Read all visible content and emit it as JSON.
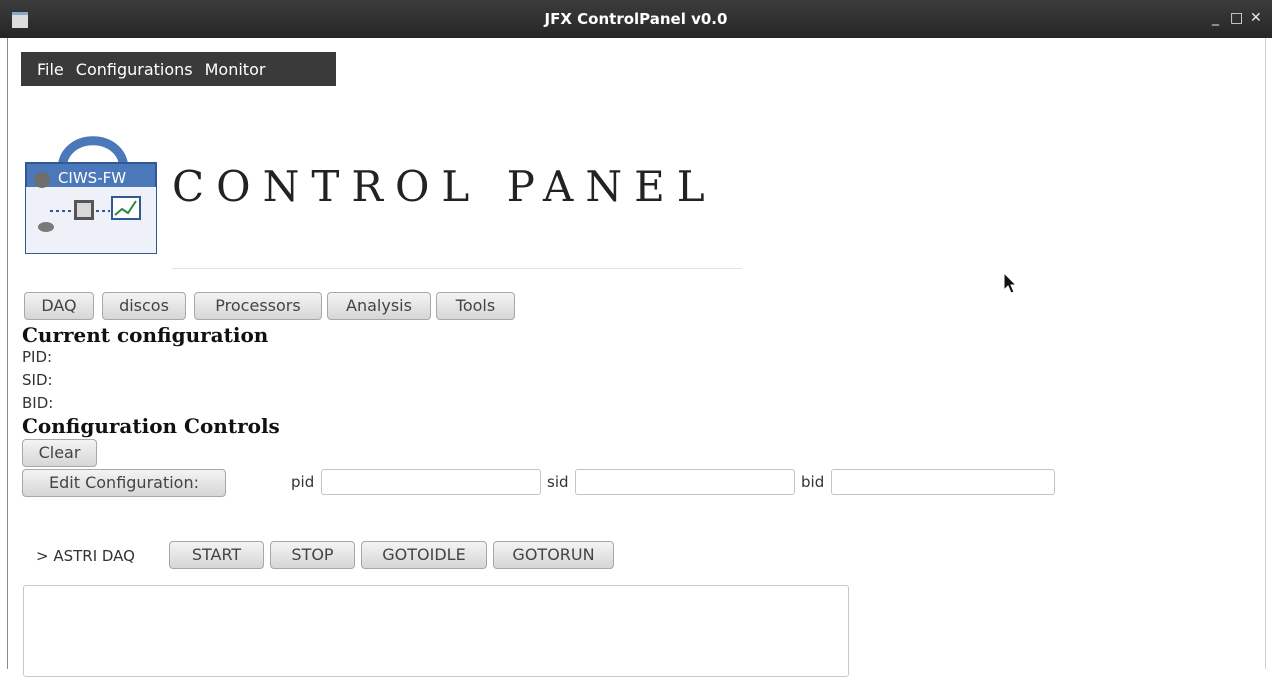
{
  "window": {
    "title": "JFX ControlPanel v0.0",
    "minimize": "_",
    "maximize": "□",
    "close": "✕"
  },
  "menubar": {
    "items": [
      "File",
      "Configurations",
      "Monitor"
    ]
  },
  "header": {
    "logo_text": "CIWS-FW",
    "title": "CONTROL PANEL"
  },
  "tabs": [
    "DAQ",
    "discos",
    "Processors",
    "Analysis",
    "Tools"
  ],
  "current_configuration": {
    "heading": "Current configuration",
    "pid_label": "PID:",
    "sid_label": "SID:",
    "bid_label": "BID:"
  },
  "configuration_controls": {
    "heading": "Configuration Controls",
    "clear_label": "Clear",
    "edit_label": "Edit Configuration:",
    "pid_label": "pid",
    "sid_label": "sid",
    "bid_label": "bid",
    "pid_value": "",
    "sid_value": "",
    "bid_value": ""
  },
  "daq": {
    "label": "> ASTRI DAQ",
    "start_label": "START",
    "stop_label": "STOP",
    "gotoidle_label": "GOTOIDLE",
    "gotorun_label": "GOTORUN"
  },
  "colors": {
    "titlebar": "#2e2e2e",
    "menubar": "#3a3a3a",
    "logo_blue": "#4a78b8"
  }
}
